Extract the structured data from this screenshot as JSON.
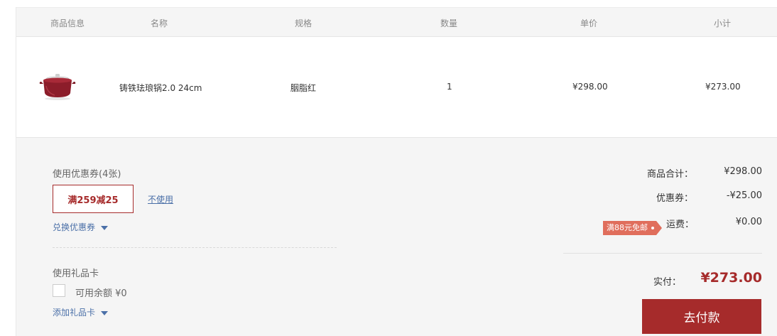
{
  "table": {
    "headers": {
      "product_info": "商品信息",
      "name": "名称",
      "spec": "规格",
      "qty": "数量",
      "unit_price": "单价",
      "subtotal": "小计"
    },
    "item": {
      "image_icon": "cast-iron-pot",
      "name": "铸铁珐琅锅2.0 24cm",
      "spec": "胭脂红",
      "qty": "1",
      "unit_price": "¥298.00",
      "subtotal": "¥273.00"
    }
  },
  "coupon": {
    "label": "使用优惠券(4张)",
    "selected": "满259减25",
    "no_use": "不使用",
    "redeem_link": "兑换优惠券"
  },
  "gift_card": {
    "label": "使用礼品卡",
    "balance_label": "可用余额 ¥0",
    "checked": false,
    "add_link": "添加礼品卡"
  },
  "summary": {
    "goods_total_label": "商品合计：",
    "goods_total": "¥298.00",
    "discount_label": "优惠券：",
    "discount": "-¥25.00",
    "shipping_badge": "满88元免邮",
    "shipping_label": "运费：",
    "shipping": "¥0.00",
    "paid_label": "实付：",
    "paid_total": "¥273.00",
    "pay_button": "去付款"
  },
  "colors": {
    "accent": "#a62b2b",
    "link": "#4b70a8",
    "badge": "#e06e5c",
    "panel_bg": "#f5f5f5"
  }
}
